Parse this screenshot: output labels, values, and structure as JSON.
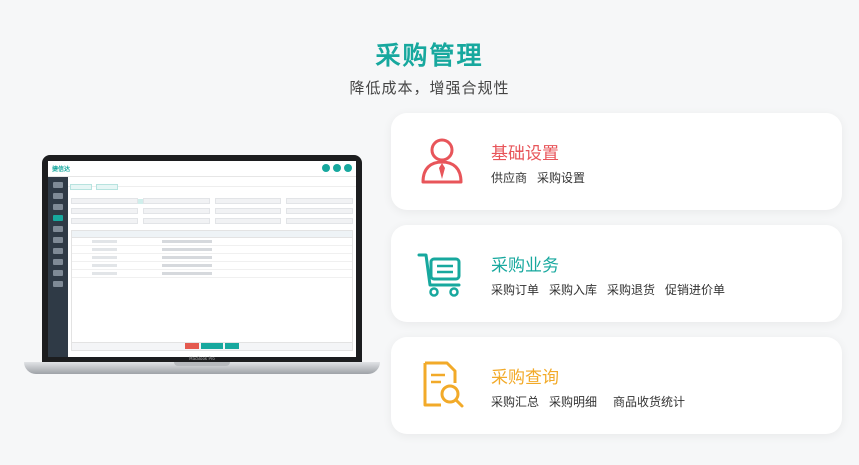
{
  "header": {
    "title": "采购管理",
    "subtitle": "降低成本，增强合规性"
  },
  "laptop": {
    "brand_label": "MacBook Pro",
    "app_logo": "捷信达"
  },
  "cards": [
    {
      "title": "基础设置",
      "color": "#e8555a",
      "icon": "user-tie-icon",
      "items": [
        "供应商",
        "采购设置"
      ]
    },
    {
      "title": "采购业务",
      "color": "#17a89e",
      "icon": "shopping-cart-icon",
      "items": [
        "采购订单",
        "采购入库",
        "采购退货",
        "促销进价单"
      ]
    },
    {
      "title": "采购查询",
      "color": "#f2aa29",
      "icon": "document-search-icon",
      "items": [
        "采购汇总",
        "采购明细",
        "商品收货统计"
      ]
    }
  ]
}
